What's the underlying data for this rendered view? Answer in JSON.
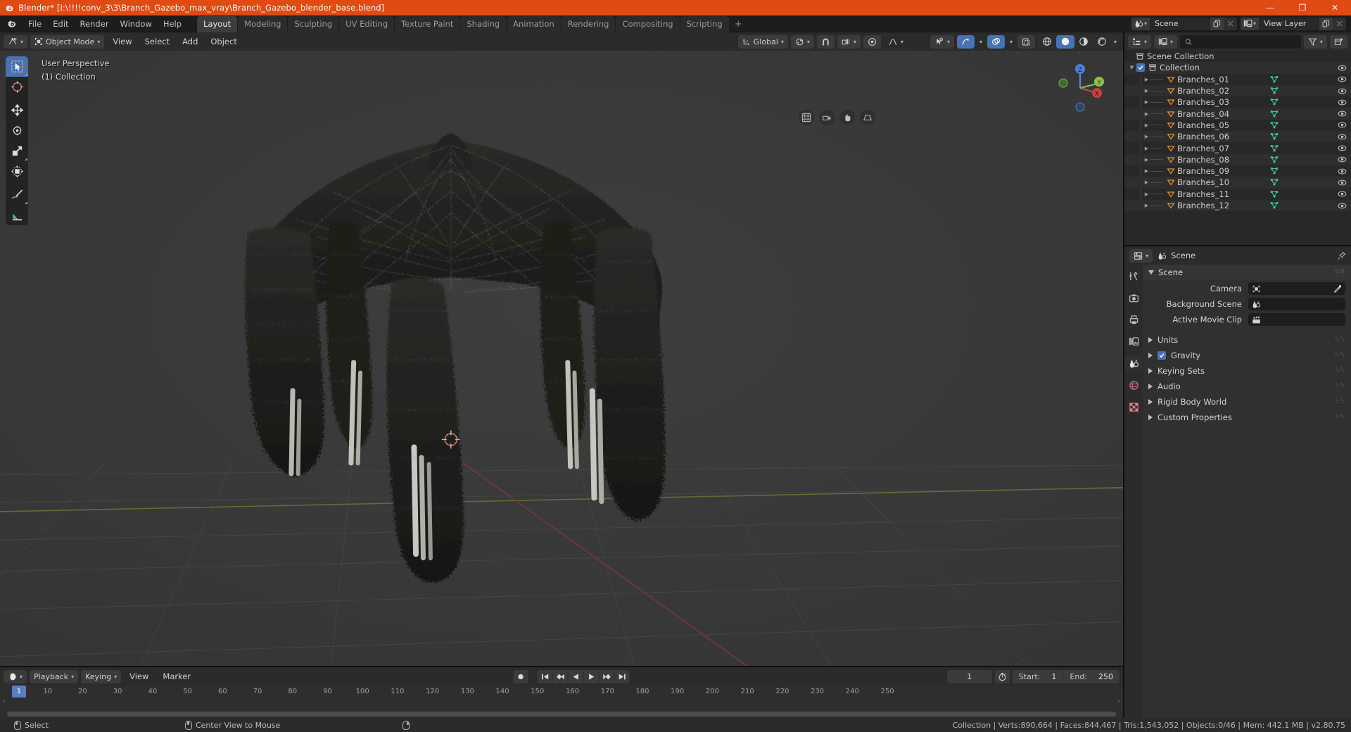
{
  "window": {
    "title": "Blender* [I:\\!!!!conv_3\\3\\Branch_Gazebo_max_vray\\Branch_Gazebo_blender_base.blend]",
    "app_icon": "blender-icon",
    "minimize": "—",
    "maximize": "❐",
    "close": "✕",
    "accent": "#e04a13"
  },
  "menubar": {
    "logo": "blender-logo-icon",
    "items": [
      "File",
      "Edit",
      "Render",
      "Window",
      "Help"
    ],
    "workspace_tabs": [
      {
        "label": "Layout",
        "active": true
      },
      {
        "label": "Modeling",
        "active": false
      },
      {
        "label": "Sculpting",
        "active": false
      },
      {
        "label": "UV Editing",
        "active": false
      },
      {
        "label": "Texture Paint",
        "active": false
      },
      {
        "label": "Shading",
        "active": false
      },
      {
        "label": "Animation",
        "active": false
      },
      {
        "label": "Rendering",
        "active": false
      },
      {
        "label": "Compositing",
        "active": false
      },
      {
        "label": "Scripting",
        "active": false
      }
    ],
    "add_workspace": "+",
    "scene": {
      "icon": "scene-icon",
      "name": "Scene",
      "new_btn": "copy-icon",
      "unlink_btn": "x-icon"
    },
    "view_layer": {
      "icon": "view-layer-icon",
      "name": "View Layer",
      "new_btn": "copy-icon",
      "unlink_btn": "x-icon"
    }
  },
  "viewport": {
    "header": {
      "editor_type": "editor-type-icon",
      "mode": "Object Mode",
      "menus": [
        "View",
        "Select",
        "Add",
        "Object"
      ],
      "transform_orientation": "Global",
      "snap_icon": "magnet-icon",
      "pivot_icon": "pivot-icon",
      "snap_target_icon": "snap-increment-icon",
      "proportional_icon": "proportional-edit-icon",
      "falloff_icon": "smooth-falloff-icon",
      "visibility_icon": "show-gizmo-icon",
      "gizmo_icon": "gizmo-icon",
      "overlays_icon": "overlays-icon",
      "xray_icon": "xray-icon",
      "shading_modes": [
        "wireframe",
        "solid",
        "material-preview",
        "rendered"
      ],
      "shading_active": "solid"
    },
    "overlay_lines": [
      "User Perspective",
      "(1) Collection"
    ],
    "toolbar": [
      {
        "name": "tweak-tool",
        "selected": true,
        "corner": true
      },
      {
        "name": "cursor-tool",
        "selected": false,
        "corner": false
      },
      {
        "name": "move-tool",
        "selected": false,
        "corner": false,
        "sep": true
      },
      {
        "name": "rotate-tool",
        "selected": false,
        "corner": false
      },
      {
        "name": "scale-tool",
        "selected": false,
        "corner": true
      },
      {
        "name": "transform-tool",
        "selected": false,
        "corner": false
      },
      {
        "name": "annotate-tool",
        "selected": false,
        "corner": true,
        "sep": true
      },
      {
        "name": "measure-tool",
        "selected": false,
        "corner": false
      }
    ],
    "gizmo_axes": [
      "X",
      "Y",
      "Z"
    ],
    "nav_buttons": [
      "zoom-nav-icon",
      "camera-nav-icon",
      "hand-nav-icon",
      "perspective-nav-icon"
    ],
    "model": "Branch Gazebo — dense dark branch mesh forming a gazebo/pavilion canopy with four corner columns",
    "cursor_3d": "3d-cursor"
  },
  "timeline": {
    "editor_icon": "timeline-editor-icon",
    "menus": [
      "Playback",
      "Keying",
      "View",
      "Marker"
    ],
    "record_button": "record-icon",
    "transport": [
      "jump-to-start",
      "jump-to-prev-keyframe",
      "play-reverse",
      "play",
      "jump-to-next-keyframe",
      "jump-to-end"
    ],
    "current_frame": "1",
    "use_preview_range_icon": "stopwatch-icon",
    "start_label": "Start:",
    "start_value": "1",
    "end_label": "End:",
    "end_value": "250",
    "ruler_ticks": [
      "10",
      "20",
      "30",
      "40",
      "50",
      "60",
      "70",
      "80",
      "90",
      "100",
      "110",
      "120",
      "130",
      "140",
      "150",
      "160",
      "170",
      "180",
      "190",
      "200",
      "210",
      "220",
      "230",
      "240",
      "250"
    ],
    "playhead_label": "1"
  },
  "outliner": {
    "editor_icon": "outliner-editor-icon",
    "display_mode_icon": "view-layer-icon",
    "search_placeholder": "",
    "search_value": "",
    "filter_icon": "filter-icon",
    "new_collection_icon": "new-collection-icon",
    "root": {
      "label": "Scene Collection",
      "icon": "collection-icon"
    },
    "collection": {
      "label": "Collection",
      "icon": "collection-icon",
      "checked": true,
      "expanded": true
    },
    "objects": [
      "Branches_01",
      "Branches_02",
      "Branches_03",
      "Branches_04",
      "Branches_05",
      "Branches_06",
      "Branches_07",
      "Branches_08",
      "Branches_09",
      "Branches_10",
      "Branches_11",
      "Branches_12"
    ],
    "object_icon": "mesh-object-icon",
    "data_icon": "mesh-data-icon",
    "visibility_icon": "eye-icon"
  },
  "properties": {
    "editor_icon": "properties-editor-icon",
    "breadcrumb_icon": "scene-icon",
    "breadcrumb": "Scene",
    "pin_icon": "pin-icon",
    "tabs": [
      {
        "name": "tool-tab",
        "active": false
      },
      {
        "name": "render-tab",
        "active": false
      },
      {
        "name": "output-tab",
        "active": false
      },
      {
        "name": "view-layer-tab",
        "active": false
      },
      {
        "name": "scene-tab",
        "active": true
      },
      {
        "name": "world-tab",
        "active": false
      },
      {
        "name": "texture-tab",
        "active": false
      }
    ],
    "panel": {
      "title": "Scene",
      "expanded": true
    },
    "fields": [
      {
        "label": "Camera",
        "value": "",
        "icon": "camera-icon",
        "action_icon": "eyedropper-icon"
      },
      {
        "label": "Background Scene",
        "value": "",
        "icon": "scene-icon",
        "action_icon": ""
      },
      {
        "label": "Active Movie Clip",
        "value": "",
        "icon": "clip-icon",
        "action_icon": ""
      }
    ],
    "sections": [
      {
        "label": "Units",
        "checkbox": null
      },
      {
        "label": "Gravity",
        "checkbox": true
      },
      {
        "label": "Keying Sets",
        "checkbox": null
      },
      {
        "label": "Audio",
        "checkbox": null
      },
      {
        "label": "Rigid Body World",
        "checkbox": null
      },
      {
        "label": "Custom Properties",
        "checkbox": null
      }
    ]
  },
  "statusbar": {
    "hints": [
      {
        "mouse": "left",
        "label": "Select"
      },
      {
        "mouse": "middle",
        "label": "Center View to Mouse"
      },
      {
        "mouse": "right",
        "label": ""
      }
    ],
    "stats": "Collection | Verts:890,664 | Faces:844,467 | Tris:1,543,052 | Objects:0/46 | Mem: 442.1 MB | v2.80.75"
  }
}
